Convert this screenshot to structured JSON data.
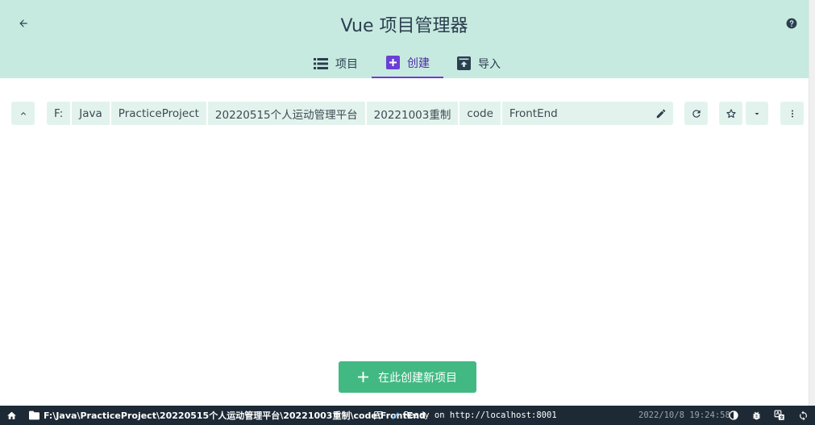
{
  "header": {
    "title": "Vue 项目管理器",
    "tabs": [
      {
        "label": "项目",
        "icon": "list-icon"
      },
      {
        "label": "创建",
        "icon": "add-box-icon"
      },
      {
        "label": "导入",
        "icon": "unarchive-icon"
      }
    ],
    "active_tab": "创建"
  },
  "path_bar": {
    "segments": [
      "F:",
      "Java",
      "PracticeProject",
      "20220515个人运动管理平台",
      "20221003重制",
      "code",
      "FrontEnd"
    ]
  },
  "create_button": {
    "label": "在此创建新项目"
  },
  "statusbar": {
    "path": "F:\\Java\\PracticeProject\\20220515个人运动管理平台\\20221003重制\\code\\FrontEnd",
    "log": "Ready on http://localhost:8001",
    "datetime": "2022/10/8  19:24:58"
  },
  "colors": {
    "header_bg": "#c6eadf",
    "accent": "#42b983",
    "active_tab": "#4f2aa8",
    "statusbar_bg": "#1d2935"
  }
}
